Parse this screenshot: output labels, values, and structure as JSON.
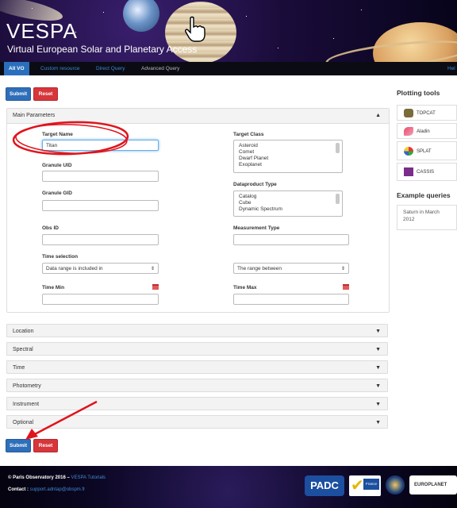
{
  "banner": {
    "title": "VESPA",
    "subtitle": "Virtual European Solar and Planetary Access"
  },
  "nav": {
    "tabs": [
      {
        "label": "All VO"
      },
      {
        "label": "Custom resource"
      },
      {
        "label": "Direct Query"
      },
      {
        "label": "Advanced Query"
      }
    ],
    "help_label": "Hel"
  },
  "actions": {
    "submit_label": "Submit",
    "reset_label": "Reset"
  },
  "main_parameters": {
    "header": "Main Parameters",
    "target_name": {
      "label": "Target Name",
      "value": "Titan"
    },
    "granule_uid": {
      "label": "Granule UID",
      "value": ""
    },
    "granule_gid": {
      "label": "Granule GID",
      "value": ""
    },
    "obs_id": {
      "label": "Obs ID",
      "value": ""
    },
    "time_selection": {
      "label": "Time selection",
      "value": "Data range is included in"
    },
    "time_min": {
      "label": "Time Min",
      "value": ""
    },
    "target_class": {
      "label": "Target Class",
      "options": [
        "Asteroid",
        "Comet",
        "Dwarf Planet",
        "Exoplanet"
      ]
    },
    "dataproduct_type": {
      "label": "Dataproduct Type",
      "options": [
        "Catalog",
        "Cube",
        "Dynamic Spectrum"
      ]
    },
    "measurement_type": {
      "label": "Measurement Type",
      "value": ""
    },
    "range_select": {
      "value": "The range between"
    },
    "time_max": {
      "label": "Time Max",
      "value": ""
    }
  },
  "sections": [
    "Location",
    "Spectral",
    "Time",
    "Photometry",
    "Instrument",
    "Optional"
  ],
  "sidebar": {
    "plotting_title": "Plotting tools",
    "tools": [
      {
        "label": "TOPCAT",
        "icon": "topcat-icon"
      },
      {
        "label": "Aladin",
        "icon": "aladin-icon"
      },
      {
        "label": "SPLAT",
        "icon": "splat-icon"
      },
      {
        "label": "CASSIS",
        "icon": "cassis-icon"
      }
    ],
    "examples_title": "Example queries",
    "example": "Saturn in March 2012"
  },
  "footer": {
    "copyright_prefix": "© Paris Observatory 2016 – ",
    "tutorials_link": "VESPA Tutorials",
    "contact_label": "Contact : ",
    "contact_email": "support.adntap@obspm.fr",
    "logos": [
      "PADC",
      "France",
      "EUROPLANET"
    ]
  },
  "annotations": {
    "highlight_color": "#e0141c",
    "accent_color": "#2f6fba"
  }
}
